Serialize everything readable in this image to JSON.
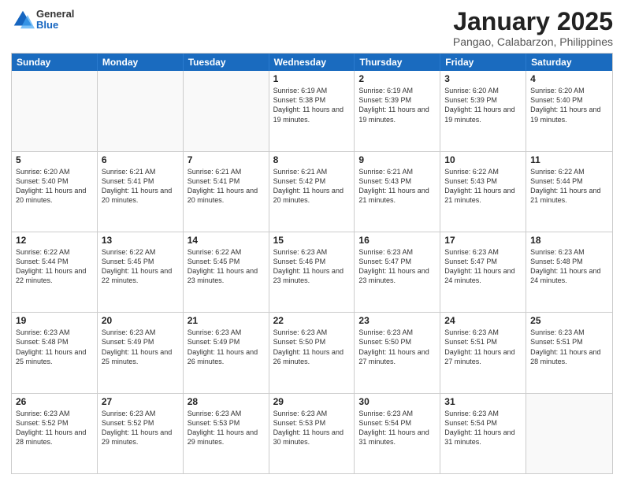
{
  "header": {
    "logo_general": "General",
    "logo_blue": "Blue",
    "title": "January 2025",
    "subtitle": "Pangao, Calabarzon, Philippines"
  },
  "weekdays": [
    "Sunday",
    "Monday",
    "Tuesday",
    "Wednesday",
    "Thursday",
    "Friday",
    "Saturday"
  ],
  "rows": [
    [
      {
        "day": "",
        "empty": true
      },
      {
        "day": "",
        "empty": true
      },
      {
        "day": "",
        "empty": true
      },
      {
        "day": "1",
        "sunrise": "6:19 AM",
        "sunset": "5:38 PM",
        "daylight": "11 hours and 19 minutes."
      },
      {
        "day": "2",
        "sunrise": "6:19 AM",
        "sunset": "5:39 PM",
        "daylight": "11 hours and 19 minutes."
      },
      {
        "day": "3",
        "sunrise": "6:20 AM",
        "sunset": "5:39 PM",
        "daylight": "11 hours and 19 minutes."
      },
      {
        "day": "4",
        "sunrise": "6:20 AM",
        "sunset": "5:40 PM",
        "daylight": "11 hours and 19 minutes."
      }
    ],
    [
      {
        "day": "5",
        "sunrise": "6:20 AM",
        "sunset": "5:40 PM",
        "daylight": "11 hours and 20 minutes."
      },
      {
        "day": "6",
        "sunrise": "6:21 AM",
        "sunset": "5:41 PM",
        "daylight": "11 hours and 20 minutes."
      },
      {
        "day": "7",
        "sunrise": "6:21 AM",
        "sunset": "5:41 PM",
        "daylight": "11 hours and 20 minutes."
      },
      {
        "day": "8",
        "sunrise": "6:21 AM",
        "sunset": "5:42 PM",
        "daylight": "11 hours and 20 minutes."
      },
      {
        "day": "9",
        "sunrise": "6:21 AM",
        "sunset": "5:43 PM",
        "daylight": "11 hours and 21 minutes."
      },
      {
        "day": "10",
        "sunrise": "6:22 AM",
        "sunset": "5:43 PM",
        "daylight": "11 hours and 21 minutes."
      },
      {
        "day": "11",
        "sunrise": "6:22 AM",
        "sunset": "5:44 PM",
        "daylight": "11 hours and 21 minutes."
      }
    ],
    [
      {
        "day": "12",
        "sunrise": "6:22 AM",
        "sunset": "5:44 PM",
        "daylight": "11 hours and 22 minutes."
      },
      {
        "day": "13",
        "sunrise": "6:22 AM",
        "sunset": "5:45 PM",
        "daylight": "11 hours and 22 minutes."
      },
      {
        "day": "14",
        "sunrise": "6:22 AM",
        "sunset": "5:45 PM",
        "daylight": "11 hours and 23 minutes."
      },
      {
        "day": "15",
        "sunrise": "6:23 AM",
        "sunset": "5:46 PM",
        "daylight": "11 hours and 23 minutes."
      },
      {
        "day": "16",
        "sunrise": "6:23 AM",
        "sunset": "5:47 PM",
        "daylight": "11 hours and 23 minutes."
      },
      {
        "day": "17",
        "sunrise": "6:23 AM",
        "sunset": "5:47 PM",
        "daylight": "11 hours and 24 minutes."
      },
      {
        "day": "18",
        "sunrise": "6:23 AM",
        "sunset": "5:48 PM",
        "daylight": "11 hours and 24 minutes."
      }
    ],
    [
      {
        "day": "19",
        "sunrise": "6:23 AM",
        "sunset": "5:48 PM",
        "daylight": "11 hours and 25 minutes."
      },
      {
        "day": "20",
        "sunrise": "6:23 AM",
        "sunset": "5:49 PM",
        "daylight": "11 hours and 25 minutes."
      },
      {
        "day": "21",
        "sunrise": "6:23 AM",
        "sunset": "5:49 PM",
        "daylight": "11 hours and 26 minutes."
      },
      {
        "day": "22",
        "sunrise": "6:23 AM",
        "sunset": "5:50 PM",
        "daylight": "11 hours and 26 minutes."
      },
      {
        "day": "23",
        "sunrise": "6:23 AM",
        "sunset": "5:50 PM",
        "daylight": "11 hours and 27 minutes."
      },
      {
        "day": "24",
        "sunrise": "6:23 AM",
        "sunset": "5:51 PM",
        "daylight": "11 hours and 27 minutes."
      },
      {
        "day": "25",
        "sunrise": "6:23 AM",
        "sunset": "5:51 PM",
        "daylight": "11 hours and 28 minutes."
      }
    ],
    [
      {
        "day": "26",
        "sunrise": "6:23 AM",
        "sunset": "5:52 PM",
        "daylight": "11 hours and 28 minutes."
      },
      {
        "day": "27",
        "sunrise": "6:23 AM",
        "sunset": "5:52 PM",
        "daylight": "11 hours and 29 minutes."
      },
      {
        "day": "28",
        "sunrise": "6:23 AM",
        "sunset": "5:53 PM",
        "daylight": "11 hours and 29 minutes."
      },
      {
        "day": "29",
        "sunrise": "6:23 AM",
        "sunset": "5:53 PM",
        "daylight": "11 hours and 30 minutes."
      },
      {
        "day": "30",
        "sunrise": "6:23 AM",
        "sunset": "5:54 PM",
        "daylight": "11 hours and 31 minutes."
      },
      {
        "day": "31",
        "sunrise": "6:23 AM",
        "sunset": "5:54 PM",
        "daylight": "11 hours and 31 minutes."
      },
      {
        "day": "",
        "empty": true
      }
    ]
  ]
}
